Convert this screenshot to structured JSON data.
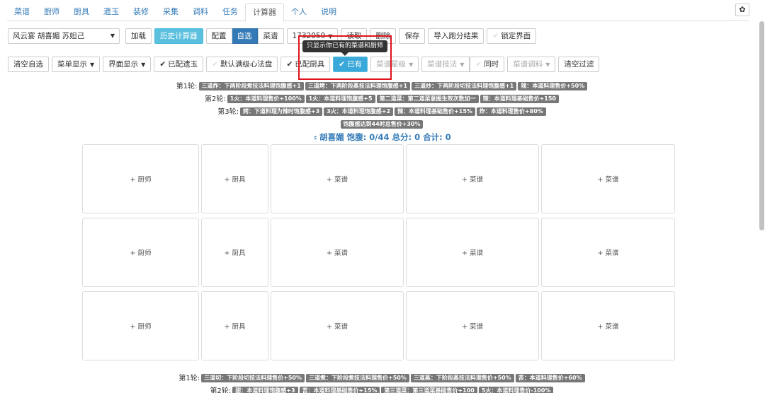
{
  "nav": {
    "tabs": [
      "菜谱",
      "厨师",
      "厨具",
      "遗玉",
      "装修",
      "采集",
      "调料",
      "任务",
      "计算器",
      "个人",
      "说明"
    ],
    "active": 8
  },
  "toolbar1": {
    "rule_select": "风云宴 胡喜媚 苏妲己",
    "load": "加载",
    "history": "历史计算器",
    "config": "配置",
    "custom": "自选",
    "recipe": "菜谱",
    "code": "1732059",
    "read": "读取",
    "delete": "删除",
    "save": "保存",
    "import": "导入跑分结果",
    "lock": "锁定界面"
  },
  "toolbar2": {
    "clear_custom": "清空自选",
    "menu_display": "菜单显示",
    "ui_display": "界面显示",
    "with_relic": "已配遗玉",
    "default_heart": "默认满级心法盘",
    "with_tool": "已配厨具",
    "owned": "已有",
    "recipe_star": "菜谱星级",
    "recipe_skill": "菜谱技法",
    "same_time": "同时",
    "recipe_seasoning": "菜谱调料",
    "clear_filter": "清空过滤"
  },
  "tooltip": "只显示你已有的菜谱和厨师",
  "rounds_top": [
    {
      "label": "第1轮:",
      "tags": [
        "三道炸：下两阶段煮技法料理饱腹感+1",
        "三道烤：下两阶段蒸技法料理饱腹感+1",
        "三道炒：下两阶段切技法料理饱腹感+1",
        "辣：本道料理售价+50%"
      ]
    },
    {
      "label": "第2轮:",
      "tags": [
        "1火：本道料理售价+100%",
        "1火：本道料理饱腹感+5",
        "第二道菜：第二道菜意图生效次数加一",
        "辣：本道料理基础售价+150"
      ]
    },
    {
      "label": "第3轮:",
      "tags": [
        "烤：下道料理为辣时饱腹感+3",
        "3火：本道料理饱腹感+2",
        "辣：本道料理基础售价+15%",
        "炸：本道料理售价+80%"
      ]
    },
    {
      "label": "",
      "tags": [
        "饱腹感达到44时总售价+30%"
      ]
    }
  ],
  "summary": "胡喜媚 饱腹: 0/44 总分: 0 合计: 0",
  "slots": {
    "chef": "+ 厨师",
    "tool": "+ 厨具",
    "recipe": "+ 菜谱"
  },
  "rounds_bottom": [
    {
      "label": "第1轮:",
      "tags": [
        "三道切：下阶段切技法料理售价+50%",
        "三道煮：下阶段煮技法料理售价+50%",
        "三道蒸：下阶段蒸技法料理售价+50%",
        "苦：本道料理售价+60%"
      ]
    },
    {
      "label": "第2轮:",
      "tags": [
        "甜：本道料理饱腹感+3",
        "苦：本道料理基础售价+15%",
        "第三道菜：第三道菜基础售价+100",
        "5火：本道料理售价-100%"
      ]
    }
  ]
}
